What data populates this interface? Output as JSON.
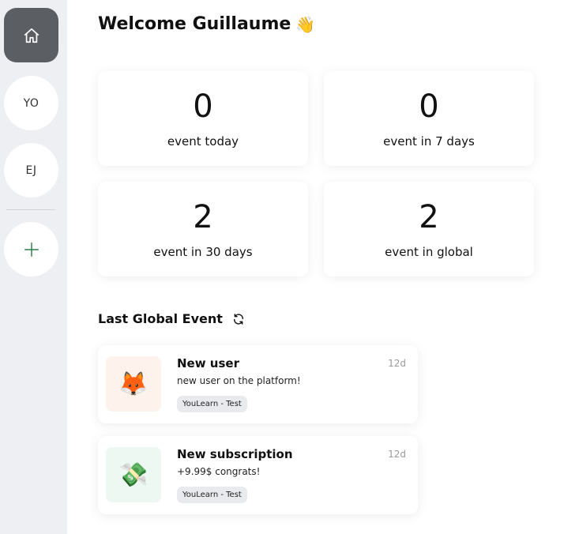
{
  "sidebar": {
    "items": [
      {
        "type": "home",
        "icon": "home-icon"
      },
      {
        "type": "project",
        "label": "YO"
      },
      {
        "type": "project",
        "label": "EJ"
      },
      {
        "type": "add",
        "icon": "plus-icon"
      }
    ]
  },
  "header": {
    "title": "Welcome Guillaume",
    "emoji": "👋"
  },
  "stats": [
    {
      "value": "0",
      "label": "event today"
    },
    {
      "value": "0",
      "label": "event in 7 days"
    },
    {
      "value": "2",
      "label": "event in 30 days"
    },
    {
      "value": "2",
      "label": "event in global"
    }
  ],
  "last_events": {
    "title": "Last Global Event",
    "items": [
      {
        "icon": "🦊",
        "icon_name": "fox-icon",
        "icon_bg": "#fdf3ec",
        "title": "New user",
        "description": "new user on the platform!",
        "tag": "YouLearn - Test",
        "time": "12d"
      },
      {
        "icon": "💸",
        "icon_name": "money-icon",
        "icon_bg": "#ecf8f1",
        "title": "New subscription",
        "description": "+9.99$ congrats!",
        "tag": "YouLearn - Test",
        "time": "12d"
      }
    ]
  },
  "colors": {
    "sidebar_bg": "#eeeff3",
    "home_active": "#5b5e63",
    "plus_green": "#2e7d4f"
  }
}
